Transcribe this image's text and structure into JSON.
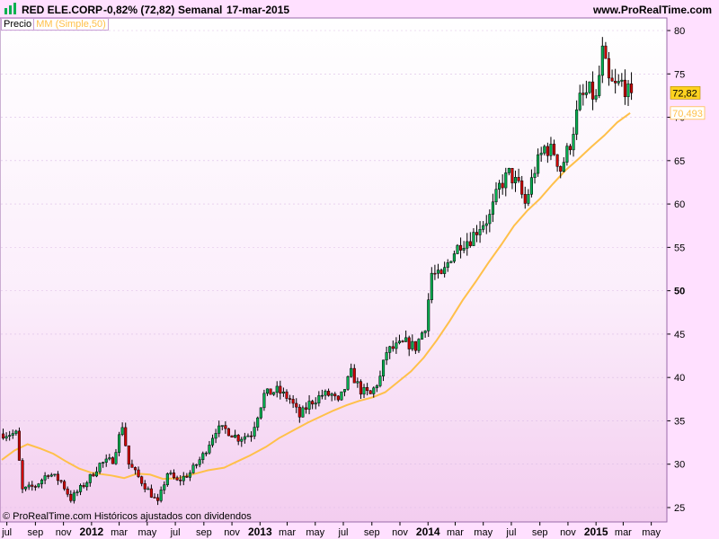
{
  "header": {
    "ticker": "RED ELE.CORP",
    "change": "-0,82% (72,82)",
    "period": "Semanal",
    "date": "17-mar-2015",
    "site": "www.ProRealTime.com"
  },
  "legend": {
    "price_label": "Precio",
    "ma_label": "MM (Simple,50)"
  },
  "footer": {
    "note": "© ProRealTime.com  Históricos ajustados con dividendos"
  },
  "colors": {
    "up": "#00b050",
    "down": "#d00000",
    "ma": "#ffc04a",
    "price_tag": "#ffd21f",
    "ma_tag": "#ffe9a0",
    "grid": "#dcbde6",
    "border": "#9a6aa8"
  },
  "chart_data": {
    "type": "candlestick",
    "x_start": "2011-06-20",
    "x_end": "2015-05-31",
    "ylim": [
      23,
      82
    ],
    "y_ticks": [
      25,
      30,
      35,
      40,
      45,
      50,
      55,
      60,
      65,
      70,
      75,
      80
    ],
    "y_tick_bold": [
      50
    ],
    "x_tick_labels": [
      {
        "label": "jul",
        "date": "2011-07-01",
        "bold": false
      },
      {
        "label": "sep",
        "date": "2011-09-01",
        "bold": false
      },
      {
        "label": "nov",
        "date": "2011-11-01",
        "bold": false
      },
      {
        "label": "2012",
        "date": "2012-01-01",
        "bold": true
      },
      {
        "label": "mar",
        "date": "2012-03-01",
        "bold": false
      },
      {
        "label": "may",
        "date": "2012-05-01",
        "bold": false
      },
      {
        "label": "jul",
        "date": "2012-07-01",
        "bold": false
      },
      {
        "label": "sep",
        "date": "2012-09-01",
        "bold": false
      },
      {
        "label": "nov",
        "date": "2012-11-01",
        "bold": false
      },
      {
        "label": "2013",
        "date": "2013-01-01",
        "bold": true
      },
      {
        "label": "mar",
        "date": "2013-03-01",
        "bold": false
      },
      {
        "label": "may",
        "date": "2013-05-01",
        "bold": false
      },
      {
        "label": "jul",
        "date": "2013-07-01",
        "bold": false
      },
      {
        "label": "sep",
        "date": "2013-09-01",
        "bold": false
      },
      {
        "label": "nov",
        "date": "2013-11-01",
        "bold": false
      },
      {
        "label": "2014",
        "date": "2014-01-01",
        "bold": true
      },
      {
        "label": "mar",
        "date": "2014-03-01",
        "bold": false
      },
      {
        "label": "may",
        "date": "2014-05-01",
        "bold": false
      },
      {
        "label": "jul",
        "date": "2014-07-01",
        "bold": false
      },
      {
        "label": "sep",
        "date": "2014-09-01",
        "bold": false
      },
      {
        "label": "nov",
        "date": "2014-11-01",
        "bold": false
      },
      {
        "label": "2015",
        "date": "2015-01-01",
        "bold": true
      },
      {
        "label": "mar",
        "date": "2015-03-01",
        "bold": false
      },
      {
        "label": "may",
        "date": "2015-05-01",
        "bold": false
      }
    ],
    "price_path": [
      [
        "2011-06-20",
        33.5
      ],
      [
        "2011-07-25",
        33.5
      ],
      [
        "2011-08-08",
        27.0
      ],
      [
        "2011-09-05",
        27.5
      ],
      [
        "2011-10-03",
        29.0
      ],
      [
        "2011-10-31",
        28.0
      ],
      [
        "2011-11-21",
        26.0
      ],
      [
        "2011-12-26",
        28.0
      ],
      [
        "2012-01-23",
        30.0
      ],
      [
        "2012-02-20",
        30.5
      ],
      [
        "2012-03-12",
        34.5
      ],
      [
        "2012-03-26",
        30.0
      ],
      [
        "2012-04-23",
        28.0
      ],
      [
        "2012-05-28",
        25.5
      ],
      [
        "2012-06-18",
        29.0
      ],
      [
        "2012-07-09",
        28.0
      ],
      [
        "2012-08-06",
        29.0
      ],
      [
        "2012-09-03",
        31.0
      ],
      [
        "2012-10-01",
        34.0
      ],
      [
        "2012-10-22",
        34.0
      ],
      [
        "2012-11-19",
        33.0
      ],
      [
        "2012-12-17",
        33.5
      ],
      [
        "2013-01-14",
        38.0
      ],
      [
        "2013-02-11",
        38.5
      ],
      [
        "2013-03-11",
        37.5
      ],
      [
        "2013-04-01",
        35.5
      ],
      [
        "2013-04-22",
        37.0
      ],
      [
        "2013-05-20",
        38.0
      ],
      [
        "2013-06-10",
        38.0
      ],
      [
        "2013-06-24",
        37.0
      ],
      [
        "2013-07-22",
        40.5
      ],
      [
        "2013-08-12",
        38.5
      ],
      [
        "2013-09-02",
        38.0
      ],
      [
        "2013-09-23",
        40.0
      ],
      [
        "2013-10-07",
        43.0
      ],
      [
        "2013-10-28",
        43.5
      ],
      [
        "2013-11-18",
        44.0
      ],
      [
        "2013-12-09",
        43.5
      ],
      [
        "2013-12-30",
        46.0
      ],
      [
        "2014-01-13",
        52.0
      ],
      [
        "2014-02-03",
        51.5
      ],
      [
        "2014-02-24",
        54.0
      ],
      [
        "2014-03-17",
        55.5
      ],
      [
        "2014-04-07",
        56.0
      ],
      [
        "2014-04-28",
        57.5
      ],
      [
        "2014-05-19",
        58.5
      ],
      [
        "2014-06-09",
        62.0
      ],
      [
        "2014-06-30",
        63.5
      ],
      [
        "2014-07-21",
        62.0
      ],
      [
        "2014-08-04",
        60.0
      ],
      [
        "2014-08-25",
        64.0
      ],
      [
        "2014-09-15",
        66.5
      ],
      [
        "2014-10-06",
        66.0
      ],
      [
        "2014-10-20",
        64.0
      ],
      [
        "2014-11-10",
        67.0
      ],
      [
        "2014-12-01",
        72.0
      ],
      [
        "2014-12-22",
        73.0
      ],
      [
        "2015-01-05",
        72.0
      ],
      [
        "2015-01-19",
        77.5
      ],
      [
        "2015-02-02",
        74.0
      ],
      [
        "2015-02-16",
        73.5
      ],
      [
        "2015-03-02",
        74.0
      ],
      [
        "2015-03-16",
        72.82
      ]
    ],
    "ma_path": [
      [
        "2011-06-20",
        30.5
      ],
      [
        "2011-07-18",
        31.6
      ],
      [
        "2011-08-15",
        32.3
      ],
      [
        "2011-09-12",
        31.8
      ],
      [
        "2011-10-10",
        31.2
      ],
      [
        "2011-11-07",
        30.3
      ],
      [
        "2011-12-05",
        29.5
      ],
      [
        "2012-01-02",
        29.0
      ],
      [
        "2012-02-13",
        28.7
      ],
      [
        "2012-03-12",
        28.4
      ],
      [
        "2012-04-09",
        28.9
      ],
      [
        "2012-05-07",
        28.8
      ],
      [
        "2012-06-04",
        28.3
      ],
      [
        "2012-07-09",
        28.4
      ],
      [
        "2012-08-13",
        28.9
      ],
      [
        "2012-09-10",
        29.3
      ],
      [
        "2012-10-15",
        29.6
      ],
      [
        "2012-11-12",
        30.3
      ],
      [
        "2012-12-10",
        31.0
      ],
      [
        "2013-01-14",
        32.0
      ],
      [
        "2013-02-11",
        33.0
      ],
      [
        "2013-03-11",
        33.8
      ],
      [
        "2013-04-15",
        34.8
      ],
      [
        "2013-05-13",
        35.5
      ],
      [
        "2013-06-10",
        36.2
      ],
      [
        "2013-07-08",
        36.8
      ],
      [
        "2013-08-05",
        37.3
      ],
      [
        "2013-09-02",
        37.7
      ],
      [
        "2013-09-30",
        38.3
      ],
      [
        "2013-10-28",
        39.5
      ],
      [
        "2013-11-25",
        40.7
      ],
      [
        "2013-12-23",
        42.3
      ],
      [
        "2014-01-20",
        44.3
      ],
      [
        "2014-02-17",
        46.5
      ],
      [
        "2014-03-17",
        48.9
      ],
      [
        "2014-04-14",
        51.0
      ],
      [
        "2014-05-12",
        53.2
      ],
      [
        "2014-06-09",
        55.3
      ],
      [
        "2014-07-07",
        57.5
      ],
      [
        "2014-08-04",
        59.2
      ],
      [
        "2014-09-01",
        60.6
      ],
      [
        "2014-09-29",
        62.3
      ],
      [
        "2014-10-27",
        63.9
      ],
      [
        "2014-11-24",
        65.2
      ],
      [
        "2014-12-22",
        66.6
      ],
      [
        "2015-01-19",
        67.9
      ],
      [
        "2015-02-16",
        69.4
      ],
      [
        "2015-03-16",
        70.493
      ]
    ],
    "series": [
      {
        "name": "Precio",
        "last": 72.82
      },
      {
        "name": "MM (Simple,50)",
        "last": 70.493
      }
    ],
    "last_price_label": "72,82",
    "ma_last_label": "70,493"
  }
}
